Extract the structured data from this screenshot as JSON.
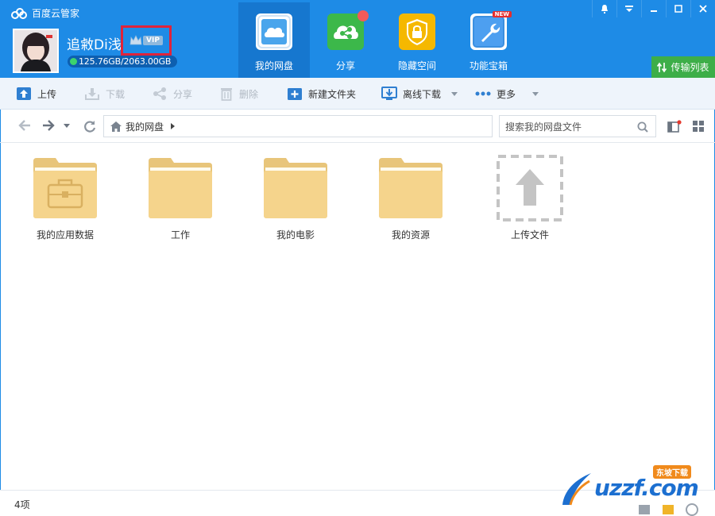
{
  "app": {
    "title": "百度云管家"
  },
  "user": {
    "name": "追敹Di浅",
    "vip_label": "VIP",
    "quota": "125.76GB/2063.00GB"
  },
  "nav_tabs": [
    {
      "label": "我的网盘",
      "icon": "cloud-icon",
      "active": true
    },
    {
      "label": "分享",
      "icon": "share-icon"
    },
    {
      "label": "隐藏空间",
      "icon": "lock-icon"
    },
    {
      "label": "功能宝箱",
      "icon": "wrench-icon",
      "badge": "NEW"
    }
  ],
  "transfer_label": "传输列表",
  "toolbar": {
    "upload": "上传",
    "download": "下载",
    "share": "分享",
    "delete": "删除",
    "new_folder": "新建文件夹",
    "offline_download": "离线下载",
    "more": "更多"
  },
  "breadcrumb": {
    "root": "我的网盘"
  },
  "search": {
    "placeholder": "搜索我的网盘文件"
  },
  "items": [
    {
      "label": "我的应用数据",
      "type": "app-folder"
    },
    {
      "label": "工作",
      "type": "folder"
    },
    {
      "label": "我的电影",
      "type": "folder"
    },
    {
      "label": "我的资源",
      "type": "folder"
    },
    {
      "label": "上传文件",
      "type": "upload-placeholder"
    }
  ],
  "status": {
    "count": "4项"
  },
  "watermark": {
    "text": "uzzf.com",
    "tag": "东坡下载"
  },
  "colors": {
    "header": "#1e8be6",
    "active_tab": "#1677cf",
    "transfer": "#3dae48",
    "folder": "#f5d48c",
    "vip_highlight": "#e0233a"
  }
}
